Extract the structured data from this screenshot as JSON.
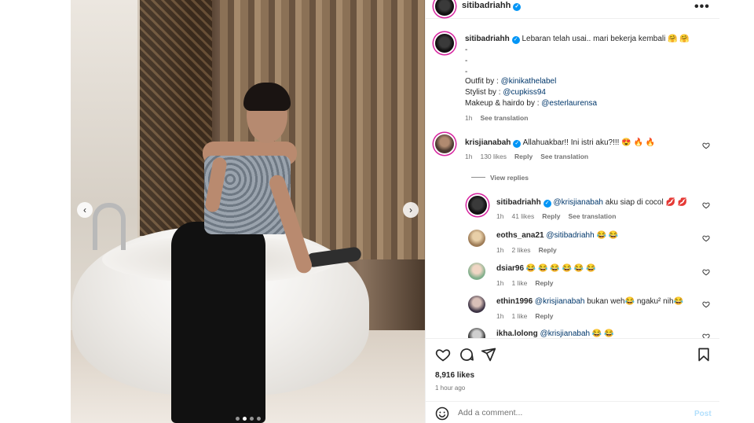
{
  "post": {
    "username": "sitibadriahh",
    "verified_icon": "✓",
    "more_label": "•••"
  },
  "caption": {
    "username": "sitibadriahh",
    "text": "Lebaran telah usai.. mari bekerja kembali 🤗 🤗",
    "dash1": "-",
    "dash2": "-",
    "dash3": "-",
    "outfit_label": "Outfit by : ",
    "outfit_handle": "@kinikathelabel",
    "stylist_label": "Stylist by : ",
    "stylist_handle": "@cupkiss94",
    "makeup_label": "Makeup & hairdo by : ",
    "makeup_handle": "@esterlaurensa",
    "time": "1h",
    "see_translation": "See translation"
  },
  "comments": [
    {
      "username": "krisjianabah",
      "text": "Allahuakbar!! Ini istri aku?!!! 😍 🔥 🔥",
      "time": "1h",
      "likes": "130 likes",
      "reply": "Reply",
      "see_translation": "See translation",
      "view_replies": "View replies"
    }
  ],
  "replies": [
    {
      "username": "sitibadriahh",
      "mention": "@krisjianabah",
      "text": " aku siap di cocol 💋 💋",
      "time": "1h",
      "likes": "41 likes",
      "reply": "Reply",
      "see_translation": "See translation"
    },
    {
      "username": "eoths_ana21",
      "mention": "@sitibadriahh",
      "text": " 😂 😂",
      "time": "1h",
      "likes": "2 likes",
      "reply": "Reply"
    },
    {
      "username": "dsiar96",
      "mention": "",
      "text": "😂 😂 😂 😂 😂 😂",
      "time": "1h",
      "likes": "1 like",
      "reply": "Reply"
    },
    {
      "username": "ethin1996",
      "mention": "@krisjianabah",
      "text": " bukan weh😂 ngaku² nih😂",
      "time": "1h",
      "likes": "1 like",
      "reply": "Reply"
    },
    {
      "username": "ikha.lolong",
      "mention": "@krisjianabah",
      "text": " 😂 😂",
      "time": "",
      "likes": "",
      "reply": ""
    }
  ],
  "footer": {
    "likes": "8,916 likes",
    "time": "1 hour ago",
    "add_comment_placeholder": "Add a comment...",
    "post_label": "Post"
  },
  "carousel": {
    "prev_icon": "‹",
    "next_icon": "›",
    "total_slides": 4,
    "active_slide": 2
  },
  "colors": {
    "link": "#00376b",
    "verified": "#0095f6",
    "muted": "#737373",
    "post_disabled": "#b2dffc"
  }
}
